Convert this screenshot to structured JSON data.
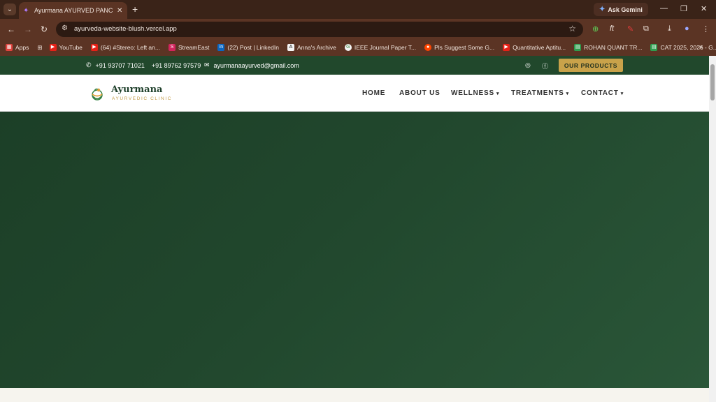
{
  "browser": {
    "tab_title": "Ayurmana AYURVED PANCHAKA",
    "url": "ayurveda-website-blush.vercel.app",
    "ask_gemini": "Ask Gemini",
    "bookmarks": [
      {
        "label": "Apps",
        "icon": "apps-grid-icon",
        "color": "#e0443e"
      },
      {
        "label": "YouTube",
        "icon": "youtube-icon",
        "color": "#e62117"
      },
      {
        "label": "(64) #Stereo: Left an...",
        "icon": "youtube-icon",
        "color": "#e62117"
      },
      {
        "label": "StreamEast",
        "icon": "streameast-icon",
        "color": "#d2245c"
      },
      {
        "label": "(22) Post | LinkedIn",
        "icon": "linkedin-icon",
        "color": "#0a66c2"
      },
      {
        "label": "Anna's Archive",
        "icon": "anna-archive-icon",
        "color": "#222222"
      },
      {
        "label": "IEEE Journal Paper T...",
        "icon": "ieee-icon",
        "color": "#f5f5f5"
      },
      {
        "label": "Pls Suggest Some G...",
        "icon": "reddit-icon",
        "color": "#ff4500"
      },
      {
        "label": "Quantitative Aptitu...",
        "icon": "youtube-icon",
        "color": "#e62117"
      },
      {
        "label": "ROHAN QUANT TR...",
        "icon": "sheet-icon",
        "color": "#2e9e4f"
      },
      {
        "label": "CAT 2025, 2026 - G...",
        "icon": "sheet-icon",
        "color": "#2e9e4f"
      }
    ]
  },
  "site": {
    "phone1": "+91 93707 71021",
    "phone2": "+91 89762 97579",
    "email": "ayurmanaayurved@gmail.com",
    "products_button": "OUR PRODUCTS",
    "logo_name": "Ayurmana",
    "logo_sub": "AYURVEDIC CLINIC",
    "nav": {
      "home": "HOME",
      "about": "ABOUT US",
      "wellness": "WELLNESS",
      "treatments": "TREATMENTS",
      "contact": "CONTACT"
    },
    "colors": {
      "topbar": "#21482c",
      "gold": "#c9a24a",
      "hero": "#21472d"
    }
  }
}
